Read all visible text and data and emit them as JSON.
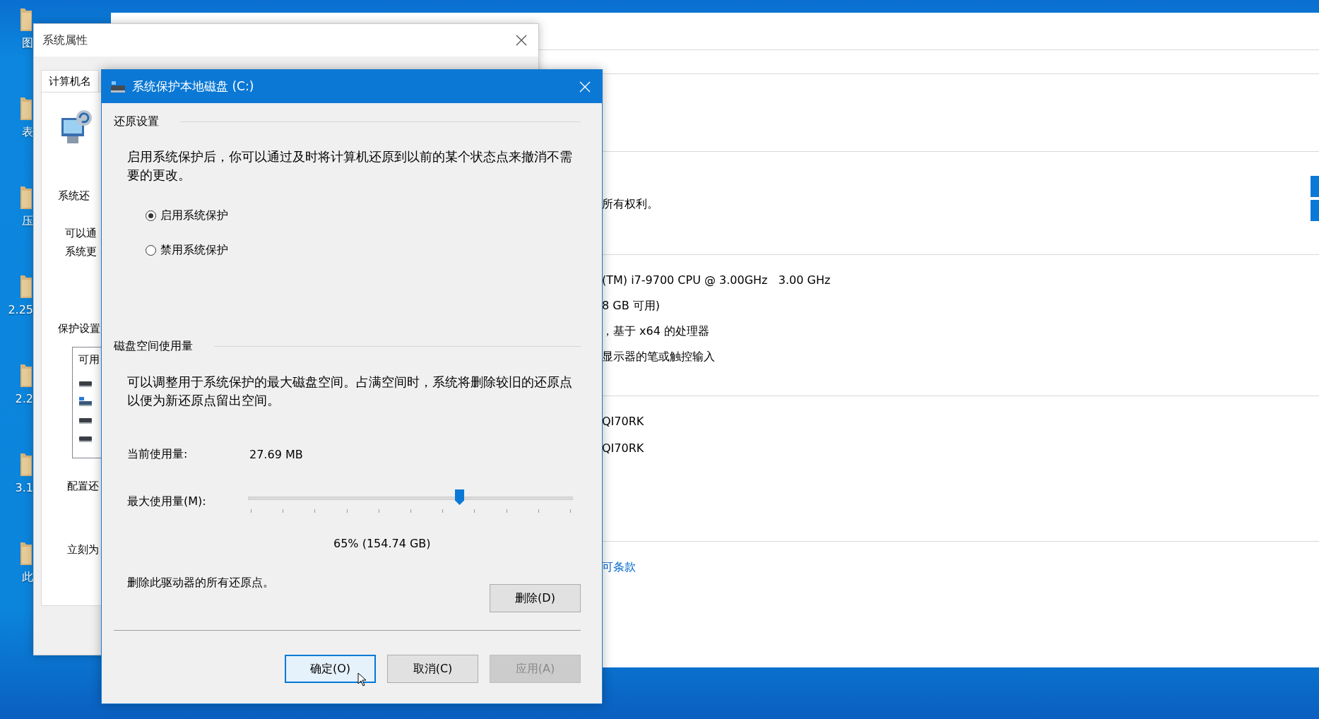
{
  "desktop": {
    "icons": [
      {
        "label": "图"
      },
      {
        "label": "表"
      },
      {
        "label": "压"
      },
      {
        "label": "2.25"
      },
      {
        "label": "2.2"
      },
      {
        "label": "3.1"
      },
      {
        "label": "此"
      }
    ]
  },
  "about_window": {
    "copyright": "所有权利。",
    "specs": [
      "(TM) i7-9700 CPU @ 3.00GHz   3.00 GHz",
      "8 GB 可用)",
      "，基于 x64 的处理器",
      "显示器的笔或触控输入"
    ],
    "ids": [
      "QI70RK",
      "QI70RK"
    ],
    "link": "可条款"
  },
  "system_properties": {
    "title": "系统属性",
    "tabs": [
      {
        "label": "计算机名",
        "selected": true
      }
    ],
    "restore_heading": "系统还",
    "restore_text": [
      "可以通",
      "系统更"
    ],
    "protection_heading": "保护设置",
    "protection_list": {
      "header": "可用",
      "drives": [
        {
          "kind": "disk"
        },
        {
          "kind": "system"
        },
        {
          "kind": "disk"
        },
        {
          "kind": "disk"
        }
      ]
    },
    "configure_text": "配置还",
    "create_text": "立刻为"
  },
  "dialog": {
    "title": "系统保护本地磁盘 (C:)",
    "restore_settings": {
      "heading": "还原设置",
      "description": "启用系统保护后，你可以通过及时将计算机还原到以前的某个状态点来撤消不需要的更改。",
      "options": [
        {
          "label": "启用系统保护",
          "selected": true
        },
        {
          "label": "禁用系统保护",
          "selected": false
        }
      ]
    },
    "disk_usage": {
      "heading": "磁盘空间使用量",
      "description": "可以调整用于系统保护的最大磁盘空间。占满空间时，系统将删除较旧的还原点以便为新还原点留出空间。",
      "current_label": "当前使用量:",
      "current_value": "27.69 MB",
      "max_label": "最大使用量(M):",
      "max_slider": {
        "level": 0.65
      },
      "max_reading": "65% (154.74 GB)",
      "delete_text": "删除此驱动器的所有还原点。",
      "delete_button": "删除(D)"
    },
    "buttons": [
      {
        "label": "确定(O)",
        "default": true,
        "disabled": false
      },
      {
        "label": "取消(C)",
        "default": false,
        "disabled": false
      },
      {
        "label": "应用(A)",
        "default": false,
        "disabled": true
      }
    ]
  }
}
